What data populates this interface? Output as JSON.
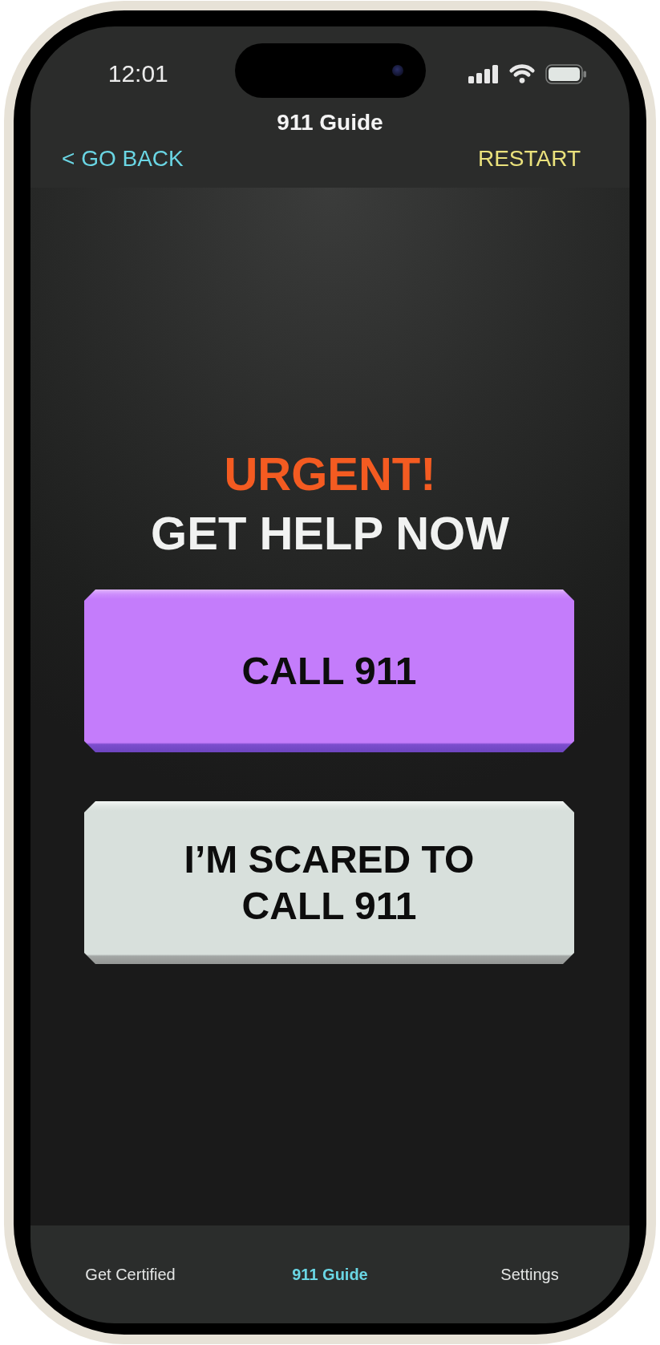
{
  "status_bar": {
    "time": "12:01"
  },
  "header": {
    "title": "911 Guide",
    "back": "< GO BACK",
    "restart": "RESTART"
  },
  "heading": {
    "alert": "URGENT!",
    "title": "GET HELP NOW"
  },
  "actions": [
    {
      "label": "CALL 911",
      "kind": "primary"
    },
    {
      "label": "I’M SCARED TO CALL 911",
      "kind": "secondary"
    }
  ],
  "tabs": [
    {
      "label": "Get Certified",
      "selected": false
    },
    {
      "label": "911 Guide",
      "selected": true
    },
    {
      "label": "Settings",
      "selected": false
    }
  ]
}
